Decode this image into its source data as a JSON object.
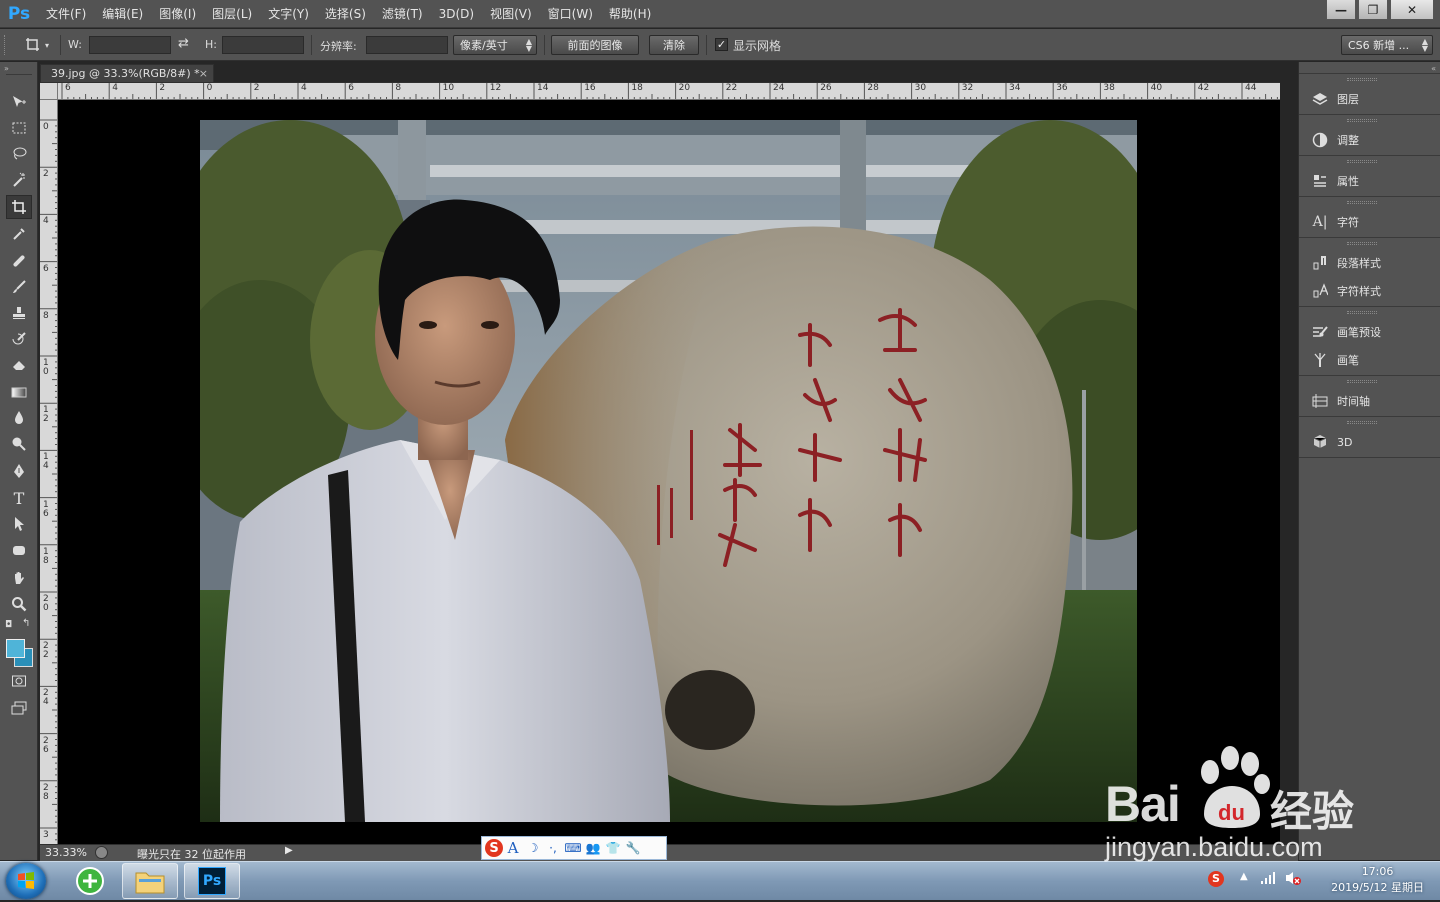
{
  "app": {
    "logo": "Ps"
  },
  "menu": [
    "文件(F)",
    "编辑(E)",
    "图像(I)",
    "图层(L)",
    "文字(Y)",
    "选择(S)",
    "滤镜(T)",
    "3D(D)",
    "视图(V)",
    "窗口(W)",
    "帮助(H)"
  ],
  "window_controls": {
    "minimize": "—",
    "restore": "❐",
    "close": "✕"
  },
  "options": {
    "w_label": "W:",
    "w_value": "",
    "h_label": "H:",
    "h_value": "",
    "resolution_label": "分辨率:",
    "resolution_value": "",
    "unit_select": "像素/英寸",
    "front_image_button": "前面的图像",
    "clear_button": "清除",
    "show_grid_checked": true,
    "show_grid_label": "显示网格",
    "workspace_select": "CS6 新增 ..."
  },
  "document": {
    "tab_title": "39.jpg @ 33.3%(RGB/8#) *",
    "tab_close": "×"
  },
  "ruler_top_labels": [
    "6",
    "4",
    "2",
    "0",
    "2",
    "4",
    "6",
    "8",
    "10",
    "12",
    "14",
    "16",
    "18",
    "20",
    "22",
    "24",
    "26",
    "28",
    "30",
    "32",
    "34",
    "36",
    "38",
    "40",
    "42",
    "44"
  ],
  "ruler_left_labels": [
    "0",
    "2",
    "4",
    "6",
    "8",
    "10",
    "12",
    "14",
    "16",
    "18",
    "20",
    "22",
    "24",
    "26",
    "28",
    "3"
  ],
  "status": {
    "zoom": "33.33%",
    "message": "曝光只在 32 位起作用"
  },
  "panels": [
    {
      "icon": "layers-icon",
      "label": "图层"
    },
    {
      "icon": "adjustments-icon",
      "label": "调整"
    },
    {
      "icon": "properties-icon",
      "label": "属性"
    },
    {
      "icon": "character-icon",
      "label": "字符"
    },
    {
      "icon": "paragraph-styles-icon",
      "label": "段落样式"
    },
    {
      "icon": "character-styles-icon",
      "label": "字符样式"
    },
    {
      "icon": "brush-presets-icon",
      "label": "画笔预设"
    },
    {
      "icon": "brush-icon",
      "label": "画笔"
    },
    {
      "icon": "timeline-icon",
      "label": "时间轴"
    },
    {
      "icon": "3d-icon",
      "label": "3D"
    }
  ],
  "photo": {
    "rock_inscription_large": [
      "学而优则用",
      "学而优则创"
    ],
    "rock_inscription_small": [
      "华罗庚",
      "一九八四十一廿二",
      "北研大"
    ]
  },
  "ime_toolbar": [
    "S",
    "A",
    "☽",
    "·,",
    "⌨",
    "👥",
    "👕",
    "🔧"
  ],
  "taskbar": {
    "time": "17:06",
    "date": "2019/5/12 星期日"
  },
  "watermark": {
    "brand_left": "Bai",
    "brand_right": "经验",
    "url": "jingyan.baidu.com"
  },
  "colors": {
    "ps_blue": "#31a8ff",
    "foreground_swatch": "#4fb4d8",
    "background_swatch": "#2a8fb8",
    "baidu_red": "#d3272c"
  }
}
